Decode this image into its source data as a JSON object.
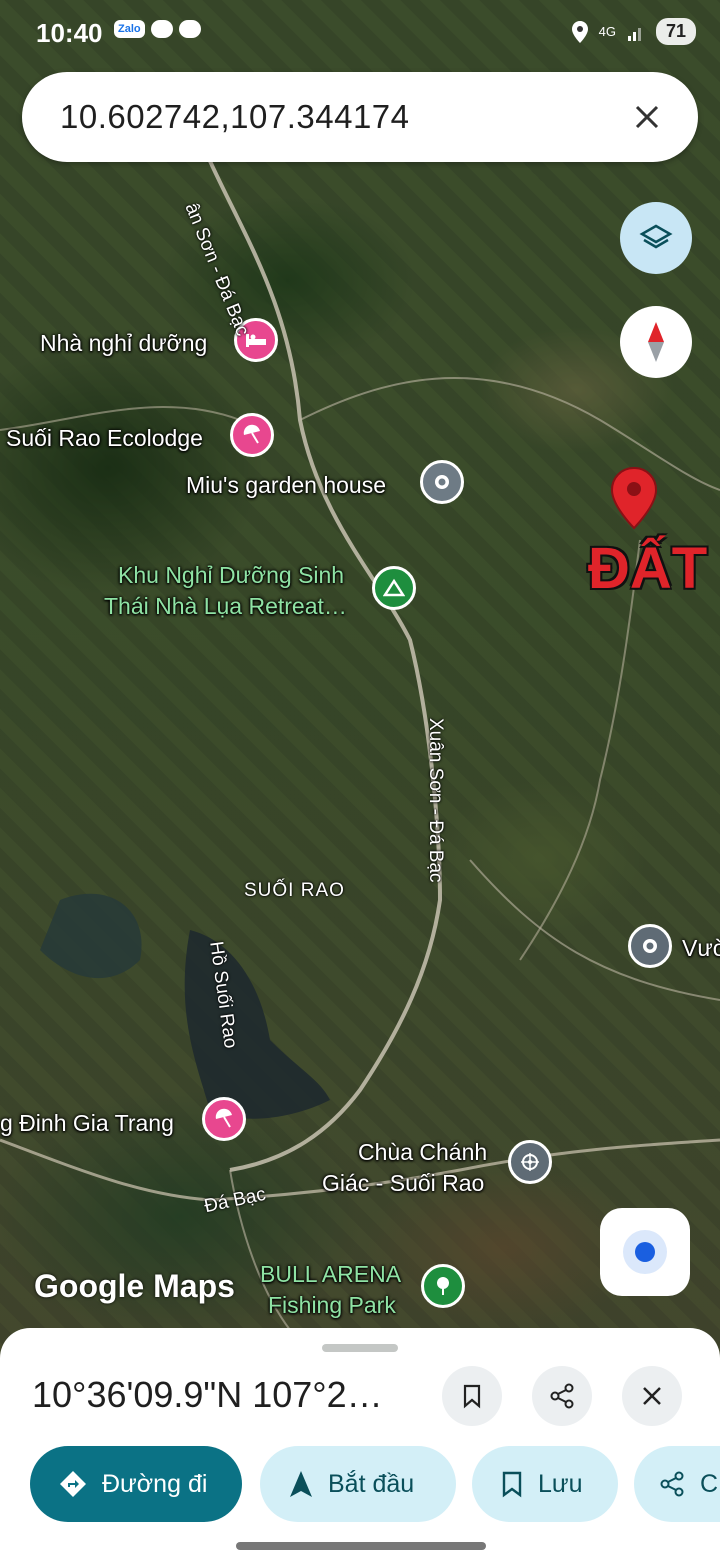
{
  "status_bar": {
    "time": "10:40",
    "notif_app": "Zalo",
    "network": "4G",
    "battery": "71"
  },
  "search": {
    "value": "10.602742,107.344174"
  },
  "map": {
    "places": [
      {
        "name": "Nhà nghỉ dưỡng",
        "icon": "hotel-icon"
      },
      {
        "name": "Suối Rao Ecolodge",
        "icon": "beach-icon"
      },
      {
        "name": "Miu's garden house",
        "icon": "place-icon"
      },
      {
        "name": "Khu Nghỉ Dưỡng Sinh",
        "icon": "camping-icon"
      },
      {
        "name": "Thái Nhà Lụa Retreat…"
      },
      {
        "name": "Vườ",
        "icon": "place-icon"
      },
      {
        "name": "g Đinh Gia Trang",
        "icon": "beach-icon"
      },
      {
        "name": "Chùa Chánh",
        "icon": "temple-icon"
      },
      {
        "name": "Giác - Suối Rao"
      },
      {
        "name": "BULL ARENA"
      },
      {
        "name": "Fishing Park",
        "icon": "park-icon"
      }
    ],
    "roads": [
      "ân Sơn - Đá Bạc",
      "Xuân Sơn - Đá Bạc",
      "Đá Bạc"
    ],
    "areas": [
      "SUỐI RAO",
      "Hồ Suối Rao"
    ],
    "annotation": "ĐẤT",
    "logo": "Google Maps"
  },
  "sheet": {
    "coords": "10°36'09.9\"N 107°2…",
    "buttons": {
      "directions": "Đường đi",
      "start": "Bắt đầu",
      "save": "Lưu",
      "share": "C"
    }
  },
  "colors": {
    "primary": "#0b7285",
    "chip": "#d3eff7",
    "pin": "#e0242a"
  }
}
